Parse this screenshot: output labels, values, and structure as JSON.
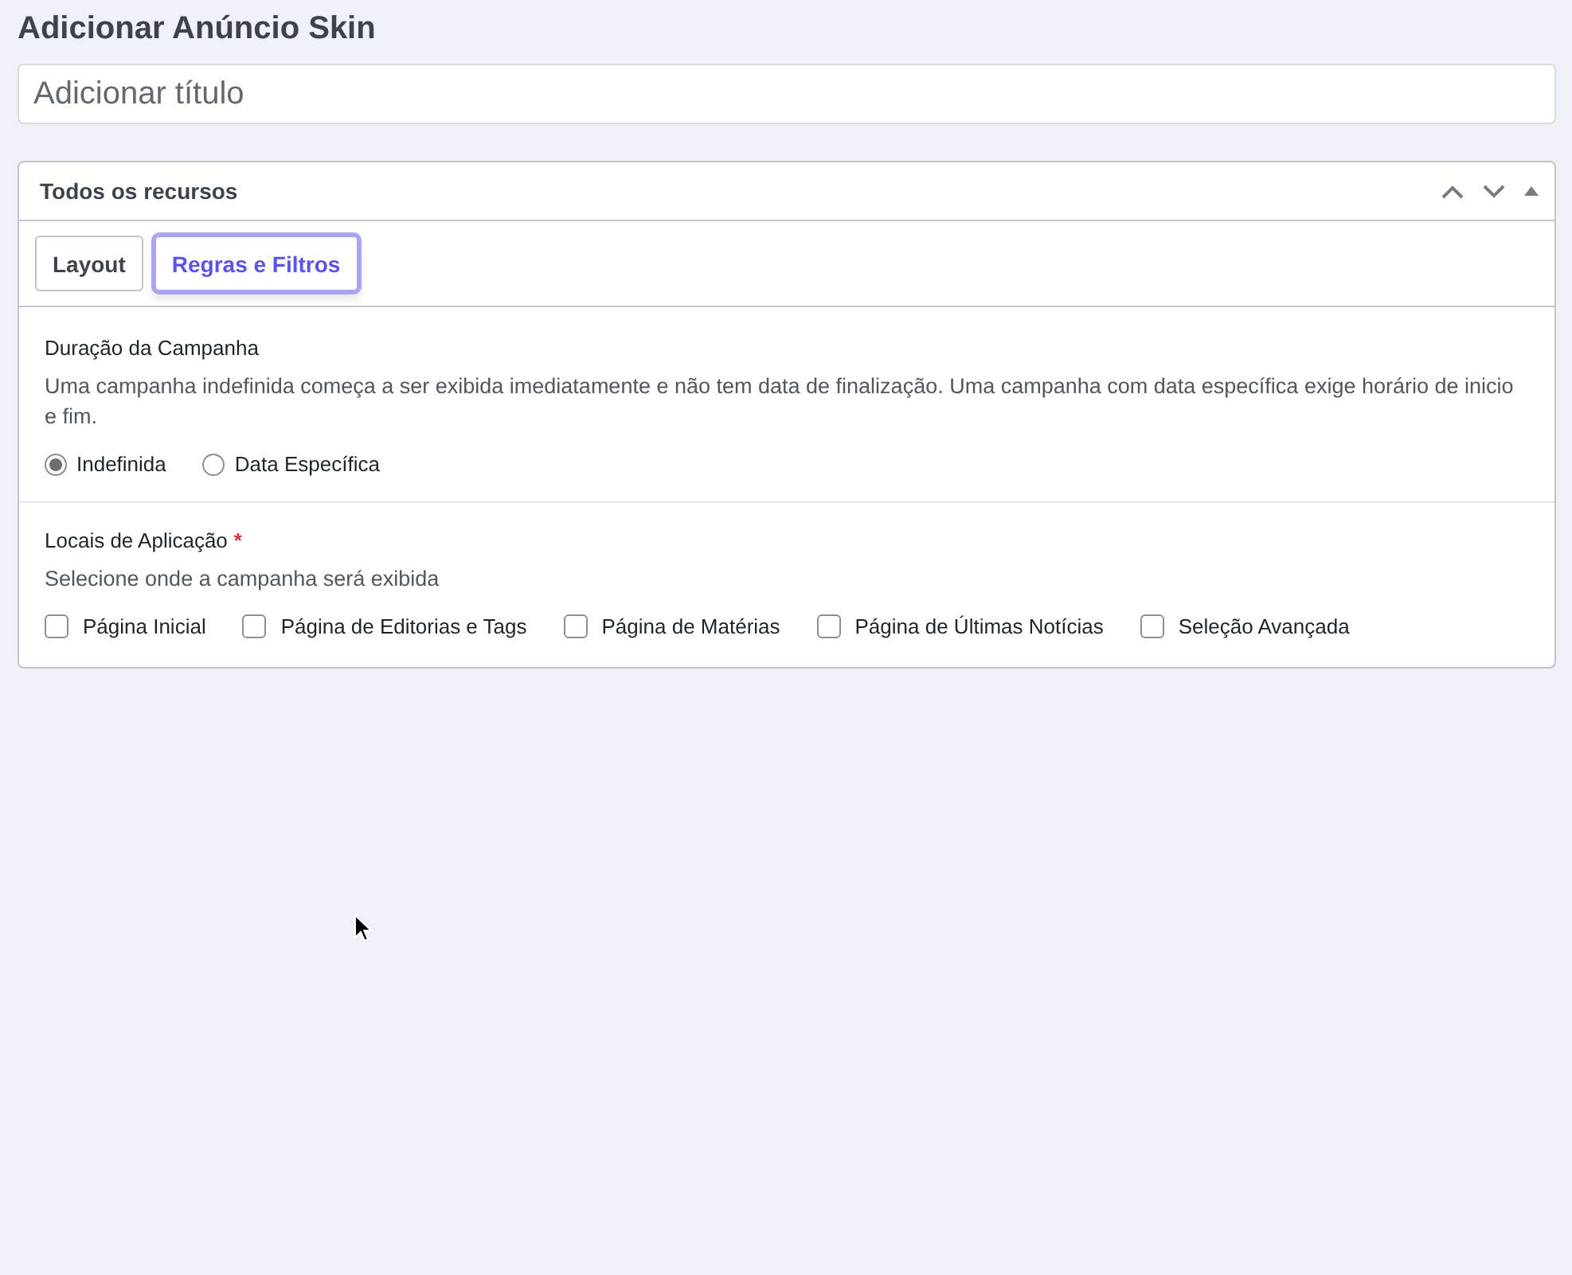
{
  "page_title": "Adicionar Anúncio Skin",
  "title_field": {
    "placeholder": "Adicionar título"
  },
  "panel": {
    "title": "Todos os recursos",
    "expanded": true,
    "tabs": [
      {
        "label": "Layout",
        "selected": false
      },
      {
        "label": "Regras e Filtros",
        "selected": true
      }
    ],
    "sections": [
      {
        "kind": "radio",
        "heading": "Duração da Campanha",
        "description": "Uma campanha indefinida começa a ser exibida imediatamente e não tem data de finalização. Uma campanha com data específica exige horário de inicio e fim.",
        "options": [
          {
            "label": "Indefinida",
            "selected": true
          },
          {
            "label": "Data Específica",
            "selected": false
          }
        ]
      },
      {
        "kind": "checkbox",
        "heading": "Locais de Aplicação",
        "required_mark": "*",
        "description": "Selecione onde a campanha será exibida",
        "options": [
          {
            "label": "Página Inicial",
            "checked": false
          },
          {
            "label": "Página de Editorias e Tags",
            "checked": false
          },
          {
            "label": "Página de Matérias",
            "checked": false
          },
          {
            "label": "Página de Últimas Notícias",
            "checked": false
          },
          {
            "label": "Seleção Avançada",
            "checked": false
          }
        ]
      }
    ]
  },
  "cursor": true
}
